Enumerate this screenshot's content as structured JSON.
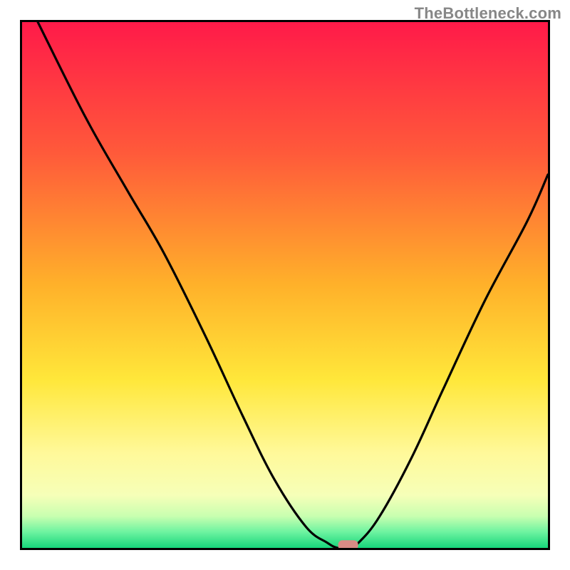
{
  "watermark": "TheBottleneck.com",
  "chart_data": {
    "type": "line",
    "title": "",
    "xlabel": "",
    "ylabel": "",
    "xlim": [
      0,
      100
    ],
    "ylim": [
      0,
      100
    ],
    "x": [
      3,
      12,
      20,
      27,
      35,
      42,
      48,
      54,
      58,
      60,
      62,
      64,
      68,
      74,
      80,
      88,
      96,
      100
    ],
    "values": [
      100,
      82,
      68,
      56,
      40,
      25,
      13,
      4,
      1,
      0,
      0,
      1,
      6,
      17,
      30,
      47,
      62,
      71
    ],
    "marker": {
      "x": 62,
      "y": 0.5
    },
    "gradient_stops": [
      {
        "offset": 0,
        "color": "#ff1a49"
      },
      {
        "offset": 25,
        "color": "#ff5a3a"
      },
      {
        "offset": 50,
        "color": "#ffb12a"
      },
      {
        "offset": 68,
        "color": "#ffe73a"
      },
      {
        "offset": 82,
        "color": "#fff99a"
      },
      {
        "offset": 90,
        "color": "#f6ffb8"
      },
      {
        "offset": 94,
        "color": "#c8ffb0"
      },
      {
        "offset": 97,
        "color": "#6cf3a0"
      },
      {
        "offset": 100,
        "color": "#17d57b"
      }
    ]
  }
}
